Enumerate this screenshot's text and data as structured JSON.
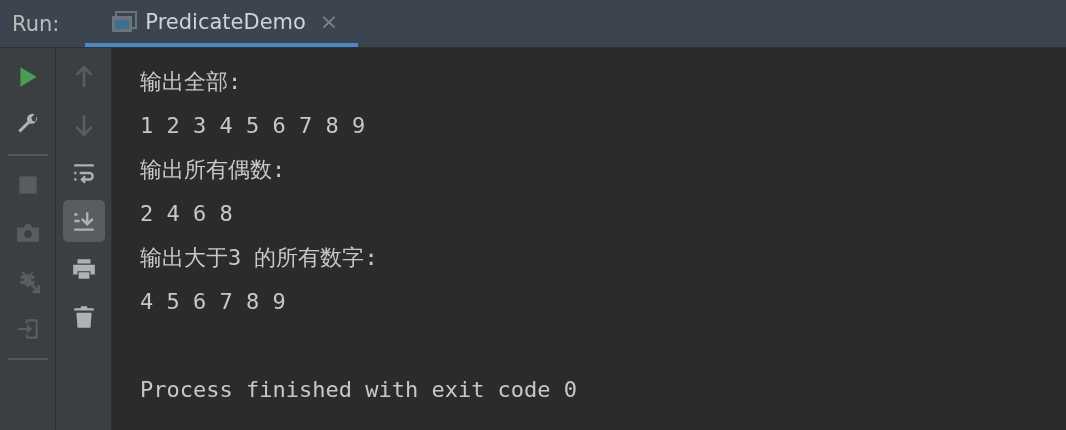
{
  "run_panel": {
    "label": "Run:",
    "tabs": [
      {
        "label": "PredicateDemo",
        "selected": true,
        "close": "×"
      }
    ]
  },
  "left_toolbar": [
    {
      "kind": "run",
      "disabled": false
    },
    {
      "kind": "wrench",
      "disabled": false
    },
    {
      "kind": "separator"
    },
    {
      "kind": "stop",
      "disabled": true
    },
    {
      "kind": "camera",
      "disabled": true
    },
    {
      "kind": "bug",
      "disabled": true
    },
    {
      "kind": "exit",
      "disabled": true
    },
    {
      "kind": "separator"
    }
  ],
  "right_toolbar": [
    {
      "kind": "up",
      "disabled": true,
      "selected": false
    },
    {
      "kind": "down",
      "disabled": true,
      "selected": false
    },
    {
      "kind": "wrap",
      "disabled": false,
      "selected": false
    },
    {
      "kind": "scroll",
      "disabled": false,
      "selected": true
    },
    {
      "kind": "print",
      "disabled": false,
      "selected": false
    },
    {
      "kind": "trash",
      "disabled": false,
      "selected": false
    }
  ],
  "console": {
    "lines": [
      "输出全部:",
      "1 2 3 4 5 6 7 8 9",
      "输出所有偶数:",
      "2 4 6 8",
      "输出大于3 的所有数字:",
      "4 5 6 7 8 9"
    ],
    "exit_message": "Process finished with exit code 0"
  }
}
